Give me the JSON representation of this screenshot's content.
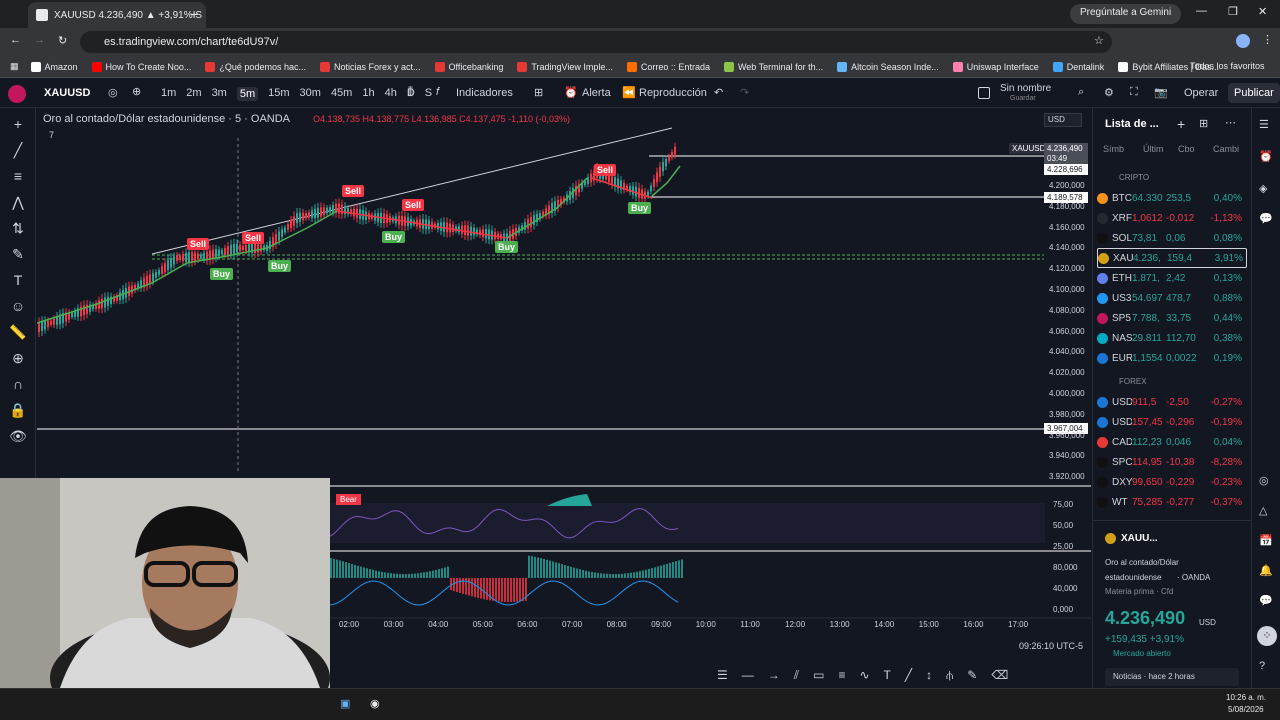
{
  "browser": {
    "tab_title": "XAUUSD 4.236,490 ▲ +3,91% S",
    "gemini": "Pregúntale a Gemini",
    "url": "es.tradingview.com/chart/te6dU97v/"
  },
  "bookmarks": [
    {
      "label": "Amazon",
      "color": "#ffffff"
    },
    {
      "label": "How To Create Noo...",
      "color": "#ff0000"
    },
    {
      "label": "¿Qué podemos hac...",
      "color": "#e53935"
    },
    {
      "label": "Noticias Forex y act...",
      "color": "#e53935"
    },
    {
      "label": "Officebanking",
      "color": "#e53935"
    },
    {
      "label": "TradingView Imple...",
      "color": "#e53935"
    },
    {
      "label": "Correo :: Entrada",
      "color": "#ff6d00"
    },
    {
      "label": "Web Terminal for th...",
      "color": "#8bc34a"
    },
    {
      "label": "Altcoin Season Inde...",
      "color": "#64b5f6"
    },
    {
      "label": "Uniswap Interface",
      "color": "#ff80ab"
    },
    {
      "label": "Dentalink",
      "color": "#42a5f5"
    },
    {
      "label": "Bybit Affiliates | Das...",
      "color": "#ffffff"
    }
  ],
  "bookmarks_all": "Todos los favoritos",
  "toolbar": {
    "symbol": "XAUUSD",
    "timeframes": [
      "1m",
      "2m",
      "3m",
      "5m",
      "15m",
      "30m",
      "45m",
      "1h",
      "4h",
      "D",
      "S"
    ],
    "active_timeframe": "5m",
    "indicators": "Indicadores",
    "alert": "Alerta",
    "replay": "Reproducción",
    "save_name": "Sin nombre",
    "save_sub": "Guardar",
    "trade": "Operar",
    "publish": "Publicar"
  },
  "chart": {
    "title": "Oro al contado/Dólar estadounidense · 5 · OANDA",
    "ohlc": "O4.138,735 H4.138,775 L4.136,985 C4.137,475 -1,110 (-0,03%)",
    "indicator_count": "7",
    "currency": "USD",
    "price_tag_symbol": "XAUUSD",
    "last_price": "4.236,490",
    "countdown": "03:49",
    "level1": "4.228,696",
    "level2": "4.189,578",
    "level3": "3.967,004",
    "price_axis": [
      "4.200,000",
      "4.180,000",
      "4.160,000",
      "4.140,000",
      "4.120,000",
      "4.100,000",
      "4.080,000",
      "4.060,000",
      "4.040,000",
      "4.020,000",
      "4.000,000",
      "3.980,000",
      "3.960,000",
      "3.940,000",
      "3.920,000"
    ],
    "time_axis": [
      "02:00",
      "03:00",
      "04:00",
      "05:00",
      "06:00",
      "07:00",
      "08:00",
      "09:00",
      "10:00",
      "11:00",
      "12:00",
      "13:00",
      "14:00",
      "15:00",
      "16:00",
      "17:00"
    ],
    "osc_axis": [
      "75,00",
      "50,00",
      "25,00"
    ],
    "macd_axis": [
      "80,000",
      "40,000",
      "0,000"
    ],
    "bear_label": "Bear",
    "clock": "09:26:10 UTC-5",
    "signals": [
      {
        "type": "Sell",
        "label": "Sell"
      },
      {
        "type": "Sell",
        "label": "Sell"
      },
      {
        "type": "Sell",
        "label": "Sell"
      },
      {
        "type": "Sell",
        "label": "Sell"
      },
      {
        "type": "Buy",
        "label": "Buy"
      },
      {
        "type": "Buy",
        "label": "Buy"
      },
      {
        "type": "Buy",
        "label": "Buy"
      },
      {
        "type": "Buy",
        "label": "Buy"
      },
      {
        "type": "Buy",
        "label": "Buy"
      },
      {
        "type": "Sell",
        "label": "Sell"
      }
    ]
  },
  "watchlist": {
    "title": "Lista de ...",
    "cols": [
      "Símb",
      "Últim",
      "Cbo",
      "Cambi"
    ],
    "section1": "CRIPTO",
    "section2": "FOREX",
    "crypto": [
      {
        "sym": "BTC",
        "last": "64.330",
        "chg": "253,5",
        "pct": "0,40%",
        "dir": "pos",
        "color": "#f7931a"
      },
      {
        "sym": "XRF",
        "last": "1,0612",
        "chg": "-0,012",
        "pct": "-1,13%",
        "dir": "neg",
        "color": "#23292f"
      },
      {
        "sym": "SOL",
        "last": "73,81",
        "chg": "0,06",
        "pct": "0,08%",
        "dir": "pos",
        "color": "#111"
      },
      {
        "sym": "XAU",
        "last": "4.236,",
        "chg": "159,4",
        "pct": "3,91%",
        "dir": "pos",
        "color": "#d4a017"
      },
      {
        "sym": "ETH",
        "last": "1.871,",
        "chg": "2,42",
        "pct": "0,13%",
        "dir": "pos",
        "color": "#627eea"
      },
      {
        "sym": "US3",
        "last": "54.697",
        "chg": "478,7",
        "pct": "0,88%",
        "dir": "pos",
        "color": "#2196f3"
      },
      {
        "sym": "SP5",
        "last": "7.788,",
        "chg": "33,75",
        "pct": "0,44%",
        "dir": "pos",
        "color": "#c2185b"
      },
      {
        "sym": "NAS",
        "last": "29.811",
        "chg": "112,70",
        "pct": "0,38%",
        "dir": "pos",
        "color": "#00acc1"
      },
      {
        "sym": "EUR",
        "last": "1,1554",
        "chg": "0,0022",
        "pct": "0,19%",
        "dir": "pos",
        "color": "#1976d2"
      }
    ],
    "forex": [
      {
        "sym": "USD",
        "last": "911,5",
        "chg": "-2,50",
        "pct": "-0,27%",
        "dir": "neg",
        "color": "#1976d2"
      },
      {
        "sym": "USD",
        "last": "157,45",
        "chg": "-0,296",
        "pct": "-0,19%",
        "dir": "neg",
        "color": "#1976d2"
      },
      {
        "sym": "CAD",
        "last": "112,23",
        "chg": "0,046",
        "pct": "0,04%",
        "dir": "pos",
        "color": "#e53935"
      },
      {
        "sym": "SPC",
        "last": "114,95",
        "chg": "-10,38",
        "pct": "-8,28%",
        "dir": "neg",
        "color": "#111"
      },
      {
        "sym": "DXY",
        "last": "99,650",
        "chg": "-0,229",
        "pct": "-0,23%",
        "dir": "neg",
        "color": "#111"
      },
      {
        "sym": "WT",
        "last": "75,285",
        "chg": "-0,277",
        "pct": "-0,37%",
        "dir": "neg",
        "color": "#111"
      }
    ]
  },
  "detail": {
    "sym": "XAUU...",
    "name1": "Oro al contado/Dólar",
    "name2": "estadounidense",
    "exchange": "· OANDA",
    "category": "Materia prima · Cfd",
    "price": "4.236,490",
    "unit": "USD",
    "change": "+159,435 +3,91%",
    "market": "Mercado abierto",
    "news": "Noticias",
    "news_time": "hace 2 horas"
  },
  "taskbar": {
    "time": "10:26 a. m.",
    "date": "5/08/2026"
  }
}
